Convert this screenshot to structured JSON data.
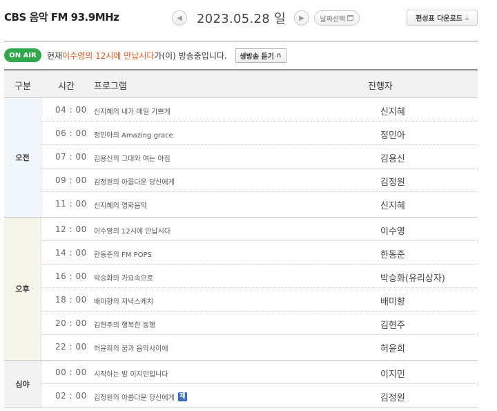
{
  "header": {
    "station": "CBS 음악 FM 93.9MHz",
    "date": "2023.05.28 일",
    "date_select_label": "날짜선택",
    "download_label": "편성표 다운로드"
  },
  "onair": {
    "badge": "ON AIR",
    "prefix": "현재 ",
    "program": "이수영의 12시에 만납시다",
    "suffix": " 가(이) 방송중입니다.",
    "live_button": "생방송 듣기"
  },
  "table": {
    "headers": {
      "section": "구분",
      "time": "시간",
      "program": "프로그램",
      "host": "진행자"
    }
  },
  "sections": [
    {
      "label": "오전",
      "rows": [
        {
          "time": "04 : 00",
          "program": "신지혜의 내가 매일 기쁘게",
          "host": "신지혜"
        },
        {
          "time": "06 : 00",
          "program": "정민아의 Amazing grace",
          "host": "정민아"
        },
        {
          "time": "07 : 00",
          "program": "김용신의 그대와 여는 아침",
          "host": "김용신"
        },
        {
          "time": "09 : 00",
          "program": "김정원의 아름다운 당신에게",
          "host": "김정원"
        },
        {
          "time": "11 : 00",
          "program": "신지혜의 영화음악",
          "host": "신지혜"
        }
      ]
    },
    {
      "label": "오후",
      "rows": [
        {
          "time": "12 : 00",
          "program": "이수영의 12시에 만납시다",
          "host": "이수영"
        },
        {
          "time": "14 : 00",
          "program": "한동준의 FM POPS",
          "host": "한동준"
        },
        {
          "time": "16 : 00",
          "program": "박승화의 가요속으로",
          "host": "박승화(유리상자)"
        },
        {
          "time": "18 : 00",
          "program": "배미향의 저녁스케치",
          "host": "배미향"
        },
        {
          "time": "20 : 00",
          "program": "김현주의 행복한 동행",
          "host": "김현주"
        },
        {
          "time": "22 : 00",
          "program": "허윤희의 꿈과 음악사이에",
          "host": "허윤희"
        }
      ]
    },
    {
      "label": "심야",
      "rows": [
        {
          "time": "00 : 00",
          "program": "시작하는 밤 이지민입니다",
          "host": "이지민"
        },
        {
          "time": "02 : 00",
          "program": "김정원의 아름다운 당신에게",
          "host": "김정원",
          "badge": "재"
        }
      ]
    }
  ]
}
